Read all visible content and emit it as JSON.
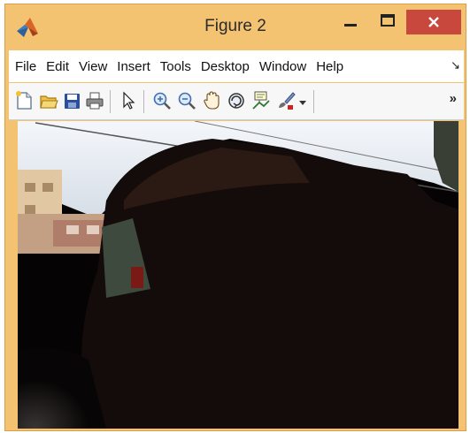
{
  "window": {
    "title": "Figure 2",
    "accent_color": "#f4c372",
    "close_color": "#c9483d"
  },
  "menu": {
    "items": [
      "File",
      "Edit",
      "View",
      "Insert",
      "Tools",
      "Desktop",
      "Window",
      "Help"
    ],
    "overflow_icon": "menu-overflow-icon"
  },
  "toolbar": {
    "icons": [
      "new-figure-icon",
      "open-file-icon",
      "save-icon",
      "print-icon",
      "pointer-icon",
      "zoom-in-icon",
      "zoom-out-icon",
      "pan-hand-icon",
      "rotate-3d-icon",
      "data-cursor-icon",
      "brush-icon",
      "dropdown-arrow-icon"
    ],
    "overflow_label": "»"
  },
  "figure": {
    "content": "photo-image"
  }
}
